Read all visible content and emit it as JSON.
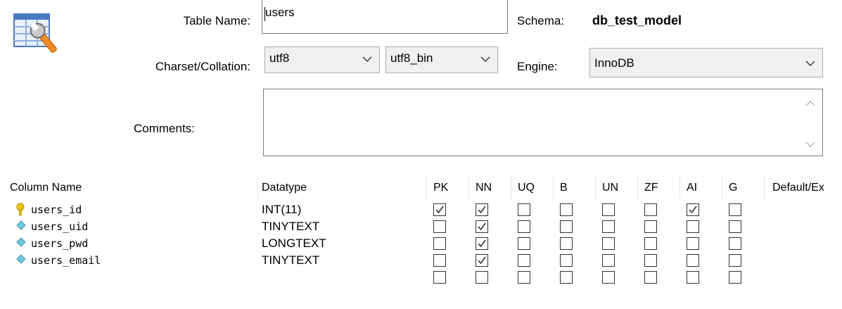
{
  "form": {
    "table_name_label": "Table Name:",
    "table_name_value": "users",
    "schema_label": "Schema:",
    "schema_value": "db_test_model",
    "charset_label": "Charset/Collation:",
    "charset_value": "utf8",
    "collation_value": "utf8_bin",
    "engine_label": "Engine:",
    "engine_value": "InnoDB",
    "comments_label": "Comments:",
    "comments_value": ""
  },
  "grid": {
    "headers": [
      "Column Name",
      "Datatype",
      "PK",
      "NN",
      "UQ",
      "B",
      "UN",
      "ZF",
      "AI",
      "G",
      "Default/Ex"
    ],
    "rows": [
      {
        "name": "users_id",
        "icon": "primary-key-icon",
        "datatype": "INT(11)",
        "flags": [
          true,
          true,
          false,
          false,
          false,
          false,
          true,
          false
        ]
      },
      {
        "name": "users_uid",
        "icon": "column-diamond-icon",
        "datatype": "TINYTEXT",
        "flags": [
          false,
          true,
          false,
          false,
          false,
          false,
          false,
          false
        ]
      },
      {
        "name": "users_pwd",
        "icon": "column-diamond-icon",
        "datatype": "LONGTEXT",
        "flags": [
          false,
          true,
          false,
          false,
          false,
          false,
          false,
          false
        ]
      },
      {
        "name": "users_email",
        "icon": "column-diamond-icon",
        "datatype": "TINYTEXT",
        "flags": [
          false,
          true,
          false,
          false,
          false,
          false,
          false,
          false
        ]
      },
      {
        "name": "",
        "icon": "",
        "datatype": "",
        "flags": [
          false,
          false,
          false,
          false,
          false,
          false,
          false,
          false
        ]
      }
    ]
  },
  "colors": {
    "checkbox_border": "#333333",
    "combo_background": "#f0f0f0",
    "diamond_icon": "#6fc7e0",
    "key_icon": "#f2c200"
  }
}
